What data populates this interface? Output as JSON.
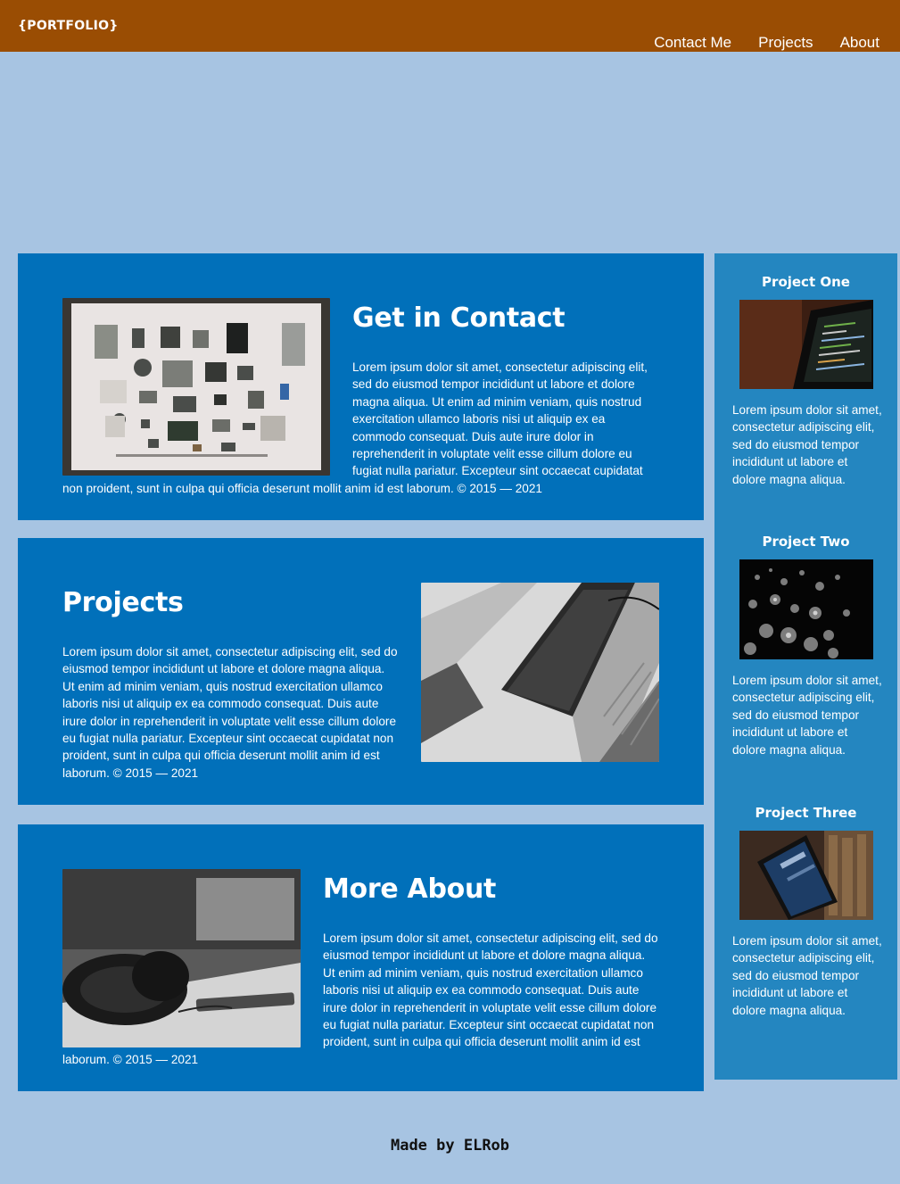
{
  "header": {
    "logo": "{PORTFOLIO}",
    "nav": [
      "Contact Me",
      "Projects",
      "About"
    ]
  },
  "sections": [
    {
      "title": "Get in Contact",
      "body": "Lorem ipsum dolor sit amet, consectetur adipiscing elit, sed do eiusmod tempor incididunt ut labore et dolore magna aliqua. Ut enim ad minim veniam, quis nostrud exercitation ullamco laboris nisi ut aliquip ex ea commodo consequat. Duis aute irure dolor in reprehenderit in voluptate velit esse cillum dolore eu fugiat nulla pariatur. Excepteur sint occaecat cupidatat non proident, sunt in culpa qui officia deserunt mollit anim id est laborum. © 2015 — 2021",
      "image": "flat-lay-electronics-photo"
    },
    {
      "title": "Projects",
      "body": "Lorem ipsum dolor sit amet, consectetur adipiscing elit, sed do eiusmod tempor incididunt ut labore et dolore magna aliqua. Ut enim ad minim veniam, quis nostrud exercitation ullamco laboris nisi ut aliquip ex ea commodo consequat. Duis aute irure dolor in reprehenderit in voluptate velit esse cillum dolore eu fugiat nulla pariatur. Excepteur sint occaecat cupidatat non proident, sunt in culpa qui officia deserunt mollit anim id est laborum. © 2015 — 2021",
      "image": "laptops-photo"
    },
    {
      "title": "More About",
      "body": "Lorem ipsum dolor sit amet, consectetur adipiscing elit, sed do eiusmod tempor incididunt ut labore et dolore magna aliqua. Ut enim ad minim veniam, quis nostrud exercitation ullamco laboris nisi ut aliquip ex ea commodo consequat. Duis aute irure dolor in reprehenderit in voluptate velit esse cillum dolore eu fugiat nulla pariatur. Excepteur sint occaecat cupidatat non proident, sunt in culpa qui officia deserunt mollit anim id est laborum. © 2015 — 2021",
      "image": "headphones-photo"
    }
  ],
  "sidebar": {
    "projects": [
      {
        "title": "Project One",
        "body": "Lorem ipsum dolor sit amet, consectetur adipiscing elit, sed do eiusmod tempor incididunt ut labore et dolore magna aliqua.",
        "image": "code-monitor-photo"
      },
      {
        "title": "Project Two",
        "body": "Lorem ipsum dolor sit amet, consectetur adipiscing elit, sed do eiusmod tempor incididunt ut labore et dolore magna aliqua.",
        "image": "fiber-optics-photo"
      },
      {
        "title": "Project Three",
        "body": "Lorem ipsum dolor sit amet, consectetur adipiscing elit, sed do eiusmod tempor incididunt ut labore et dolore magna aliqua.",
        "image": "tablet-books-photo"
      }
    ]
  },
  "footer": {
    "text": "Made by ELRob"
  },
  "colors": {
    "page_background": "#a7c4e2",
    "header": "#9a4d03",
    "card": "#0170ba",
    "sidebar": "#2486c0",
    "text": "#ffffff"
  }
}
